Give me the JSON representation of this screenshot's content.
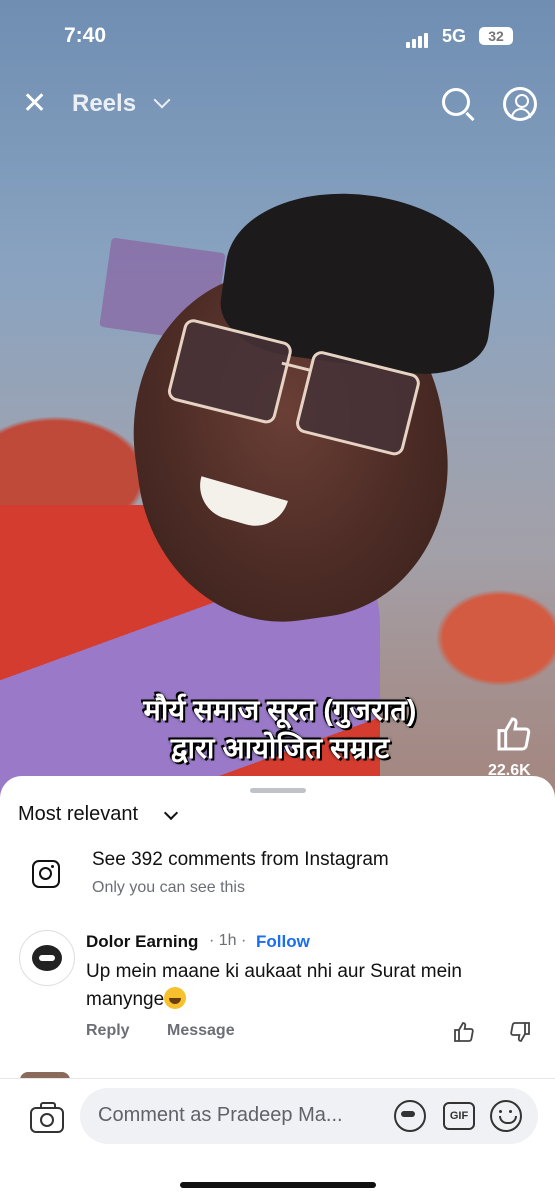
{
  "status_bar": {
    "time": "7:40",
    "network": "5G",
    "battery": "32"
  },
  "header": {
    "title": "Reels"
  },
  "video": {
    "caption_line1": "मौर्य समाज सूरत (गुजरात)",
    "caption_line2": "द्वारा आयोजित सम्राट",
    "like_count": "22.6K"
  },
  "comments_sheet": {
    "sort_label": "Most relevant",
    "instagram_link": "See 392 comments from Instagram",
    "instagram_note": "Only you can see this",
    "comments": [
      {
        "author": "Dolor Earning",
        "time": "· 1h ·",
        "follow_label": "Follow",
        "text": "Up mein maane ki aukaat nhi aur Surat mein manynge",
        "reply_label": "Reply",
        "message_label": "Message"
      }
    ]
  },
  "composer": {
    "placeholder": "Comment as Pradeep Ma..."
  },
  "icons": [
    "close-icon",
    "chevron-down-icon",
    "search-icon",
    "profile-icon",
    "like-icon",
    "instagram-icon",
    "camera-icon",
    "avatar-sticker-icon",
    "gif-icon",
    "emoji-icon",
    "thumbs-up-icon",
    "thumbs-down-icon"
  ]
}
